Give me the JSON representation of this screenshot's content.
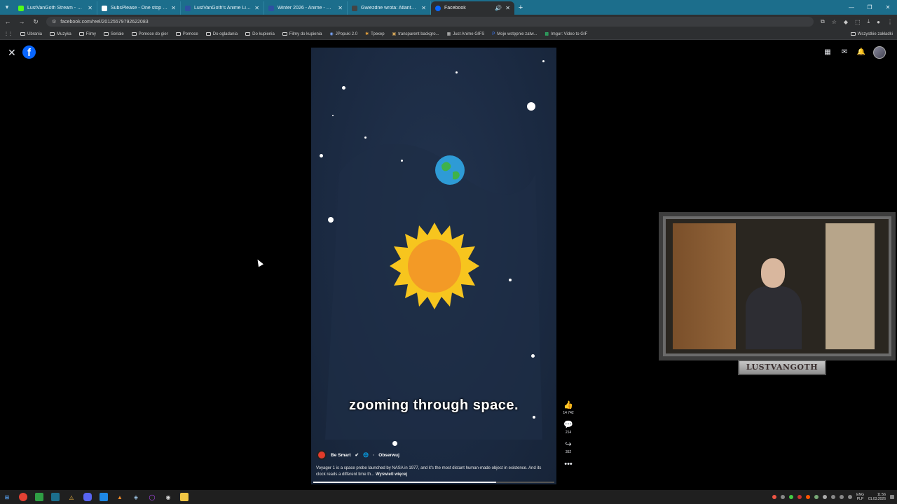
{
  "browser": {
    "tabs": [
      {
        "title": "LustVanGoth Stream - Watch Li",
        "color": "#53fc18"
      },
      {
        "title": "SubsPlease - One stop shop fo",
        "color": "#ffffff"
      },
      {
        "title": "LustVanGoth's Anime List - My",
        "color": "#2e51a2"
      },
      {
        "title": "Winter 2026 - Anime - MyAnim",
        "color": "#2e51a2"
      },
      {
        "title": "Gwiezdne wrota: Atlantyda / St",
        "color": "#444444"
      },
      {
        "title": "Facebook",
        "color": "#0866ff"
      }
    ],
    "url": "facebook.com/reel/2012557979262208​3",
    "bookmarks": [
      "Ubrania",
      "Muzyka",
      "Filmy",
      "Seriale",
      "Pomoce do gier",
      "Pomoce",
      "Do ogladania",
      "Do kupienia",
      "Filmy do kupienia",
      "JPopuki 2.0",
      "Трекер",
      "transparent backgro...",
      "Just Anime GIFS",
      "Moje wstępnie zatw...",
      "Imgur: Video to GIF"
    ],
    "bookmarks_right": "Wszystkie zakładki"
  },
  "reel": {
    "caption": "zooming through space.",
    "author": "Be Smart",
    "follow": "Obserwuj",
    "description": "Voyager 1 is a space probe launched by NASA in 1977, and it's the most distant human-made object in existence. And its clock reads a different time th...",
    "see_more": "Wyświetl więcej",
    "likes": "14 742",
    "comments": "214",
    "shares": "352",
    "progress": 0.76
  },
  "stream": {
    "nameplate": "LUSTVANGOTH"
  },
  "tray": {
    "lang1": "ENG",
    "lang2": "PLP",
    "time": "11:56",
    "date": "01.03.2026"
  }
}
